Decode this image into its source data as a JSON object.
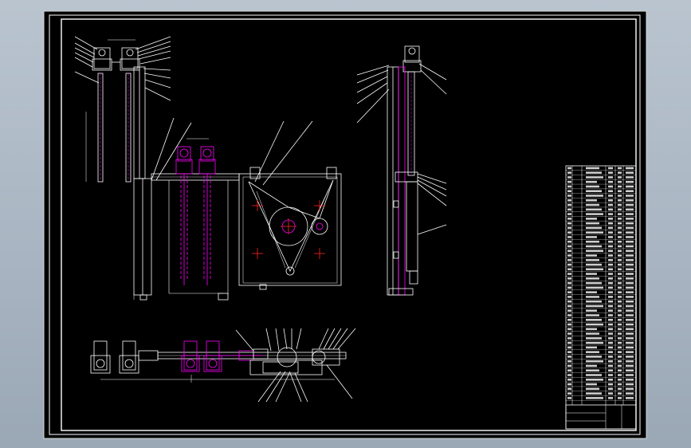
{
  "title": "",
  "colors": {
    "viewport_bg": "#a9b5c2",
    "sheet_bg": "#000000",
    "line_white": "#ffffff",
    "line_magenta": "#ff00ff",
    "line_red": "#ff2222",
    "line_gray": "#8a8a8a"
  },
  "title_block": {
    "rows": 52,
    "columns": 6,
    "note": ""
  },
  "views": [
    {
      "id": "top-left-side-view",
      "label": ""
    },
    {
      "id": "front-elevation-view",
      "label": ""
    },
    {
      "id": "right-side-view",
      "label": ""
    },
    {
      "id": "bottom-plan-view",
      "label": ""
    }
  ]
}
